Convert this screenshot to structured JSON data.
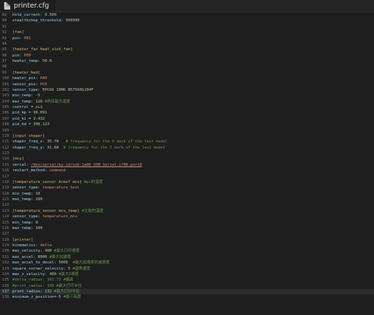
{
  "window": {
    "tab_label": "printer.cfg"
  },
  "colors": {
    "background": "#1e1e1e",
    "key": "#9cdcfe",
    "section": "#d7ba7d",
    "number": "#b5cea8",
    "string": "#ce9178",
    "comment": "#6a9955",
    "line_number": "#858585"
  },
  "editor": {
    "current_line": "137",
    "lines": [
      {
        "n": "89",
        "segs": [
          {
            "t": "hold_current: ",
            "c": "k"
          },
          {
            "t": "0.500",
            "c": "v"
          }
        ]
      },
      {
        "n": "90",
        "segs": [
          {
            "t": "stealthchop_threshold: ",
            "c": "k"
          },
          {
            "t": "999999",
            "c": "v"
          }
        ]
      },
      {
        "n": "91",
        "segs": []
      },
      {
        "n": "92",
        "segs": [
          {
            "t": "[fan]",
            "c": "h"
          }
        ]
      },
      {
        "n": "93",
        "segs": [
          {
            "t": "pin: ",
            "c": "k"
          },
          {
            "t": "PB1",
            "c": "s"
          }
        ]
      },
      {
        "n": "94",
        "segs": []
      },
      {
        "n": "95",
        "segs": [
          {
            "t": "[heater_fan heat_sink_fan]",
            "c": "h"
          }
        ]
      },
      {
        "n": "96",
        "segs": [
          {
            "t": "pin: ",
            "c": "k"
          },
          {
            "t": "PB0",
            "c": "s"
          }
        ]
      },
      {
        "n": "97",
        "segs": [
          {
            "t": "heater_temp: ",
            "c": "k"
          },
          {
            "t": "50.0",
            "c": "v"
          }
        ]
      },
      {
        "n": "98",
        "segs": []
      },
      {
        "n": "99",
        "segs": [
          {
            "t": "[heater_bed]",
            "c": "h"
          }
        ]
      },
      {
        "n": "100",
        "segs": [
          {
            "t": "heater_pin: ",
            "c": "k"
          },
          {
            "t": "PA0",
            "c": "s"
          }
        ]
      },
      {
        "n": "101",
        "segs": [
          {
            "t": "sensor_pin: ",
            "c": "k"
          },
          {
            "t": "PC0",
            "c": "s"
          }
        ]
      },
      {
        "n": "102",
        "segs": [
          {
            "t": "sensor_type: ",
            "c": "k"
          },
          {
            "t": "EPCOS 100K B57560G104F",
            "c": "v"
          }
        ]
      },
      {
        "n": "103",
        "segs": [
          {
            "t": "min_temp: ",
            "c": "k"
          },
          {
            "t": "-5",
            "c": "v"
          }
        ]
      },
      {
        "n": "104",
        "segs": [
          {
            "t": "max_temp: ",
            "c": "k"
          },
          {
            "t": "120 ",
            "c": "v"
          },
          {
            "t": "#热床最大温度",
            "c": "c"
          }
        ]
      },
      {
        "n": "105",
        "segs": [
          {
            "t": "control = ",
            "c": "k"
          },
          {
            "t": "pid",
            "c": "s"
          }
        ]
      },
      {
        "n": "106",
        "segs": [
          {
            "t": "pid_kp = ",
            "c": "k"
          },
          {
            "t": "90.091",
            "c": "v"
          }
        ]
      },
      {
        "n": "107",
        "segs": [
          {
            "t": "pid_ki = ",
            "c": "k"
          },
          {
            "t": "2.432",
            "c": "v"
          }
        ]
      },
      {
        "n": "108",
        "segs": [
          {
            "t": "pid_kd = ",
            "c": "k"
          },
          {
            "t": "300.123",
            "c": "v"
          }
        ]
      },
      {
        "n": "109",
        "segs": []
      },
      {
        "n": "110",
        "segs": [
          {
            "t": "[input_shaper]",
            "c": "h"
          }
        ]
      },
      {
        "n": "111",
        "segs": [
          {
            "t": "shaper_freq_x: ",
            "c": "k"
          },
          {
            "t": "35.78",
            "c": "v"
          },
          {
            "t": "   # frequency for the X mark of the test model",
            "c": "c"
          }
        ]
      },
      {
        "n": "112",
        "segs": [
          {
            "t": "shaper_freq_y: ",
            "c": "k"
          },
          {
            "t": "31.68",
            "c": "v"
          },
          {
            "t": "  # frequency for the Y mark of the test model",
            "c": "c"
          }
        ]
      },
      {
        "n": "113",
        "segs": []
      },
      {
        "n": "114",
        "segs": [
          {
            "t": "[mcu]",
            "c": "h"
          }
        ]
      },
      {
        "n": "115",
        "segs": [
          {
            "t": "serial: ",
            "c": "k"
          },
          {
            "t": "/dev/serial/by-id/usb-1a86_USB_Serial-if00-port0",
            "c": "u"
          }
        ]
      },
      {
        "n": "116",
        "segs": [
          {
            "t": "restart_method: ",
            "c": "k"
          },
          {
            "t": "command",
            "c": "s"
          }
        ]
      },
      {
        "n": "117",
        "segs": []
      },
      {
        "n": "118",
        "segs": [
          {
            "t": "[temperature_sensor Armv7 mcu] ",
            "c": "h"
          },
          {
            "t": "#pi的温度",
            "c": "c"
          }
        ]
      },
      {
        "n": "119",
        "segs": [
          {
            "t": "sensor_type: ",
            "c": "k"
          },
          {
            "t": "temperature_host",
            "c": "s"
          }
        ]
      },
      {
        "n": "120",
        "segs": [
          {
            "t": "min_temp: ",
            "c": "k"
          },
          {
            "t": "10",
            "c": "v"
          }
        ]
      },
      {
        "n": "121",
        "segs": [
          {
            "t": "max_temp: ",
            "c": "k"
          },
          {
            "t": "100",
            "c": "v"
          }
        ]
      },
      {
        "n": "122",
        "segs": []
      },
      {
        "n": "123",
        "segs": [
          {
            "t": "[temperature_sensor mcu_temp] ",
            "c": "h"
          },
          {
            "t": "#主板的温度",
            "c": "c"
          }
        ]
      },
      {
        "n": "124",
        "segs": [
          {
            "t": "sensor_type: ",
            "c": "k"
          },
          {
            "t": "temperature_mcu",
            "c": "s"
          }
        ]
      },
      {
        "n": "125",
        "segs": [
          {
            "t": "min_temp: ",
            "c": "k"
          },
          {
            "t": "0",
            "c": "v"
          }
        ]
      },
      {
        "n": "126",
        "segs": [
          {
            "t": "max_temp: ",
            "c": "k"
          },
          {
            "t": "100",
            "c": "v"
          }
        ]
      },
      {
        "n": "127",
        "segs": []
      },
      {
        "n": "128",
        "segs": [
          {
            "t": "[printer]",
            "c": "h"
          }
        ]
      },
      {
        "n": "129",
        "segs": [
          {
            "t": "kinematics: ",
            "c": "k"
          },
          {
            "t": "delta",
            "c": "s"
          }
        ]
      },
      {
        "n": "130",
        "segs": [
          {
            "t": "max_velocity: ",
            "c": "k"
          },
          {
            "t": "400 ",
            "c": "v"
          },
          {
            "t": "#最大打印速度",
            "c": "c"
          }
        ]
      },
      {
        "n": "131",
        "segs": [
          {
            "t": "max_accel: ",
            "c": "k"
          },
          {
            "t": "8000 ",
            "c": "v"
          },
          {
            "t": "#最大加速度",
            "c": "c"
          }
        ]
      },
      {
        "n": "132",
        "segs": [
          {
            "t": "max_accel_to_decel: ",
            "c": "k"
          },
          {
            "t": "5000",
            "c": "v"
          },
          {
            "t": "  #最大加速度到减速度",
            "c": "c"
          }
        ]
      },
      {
        "n": "133",
        "segs": [
          {
            "t": "square_corner_velocity: ",
            "c": "k"
          },
          {
            "t": "5 ",
            "c": "v"
          },
          {
            "t": "#直角速度",
            "c": "c"
          }
        ]
      },
      {
        "n": "134",
        "segs": [
          {
            "t": "max_z_velocity: ",
            "c": "k"
          },
          {
            "t": "400 ",
            "c": "v"
          },
          {
            "t": "#最大Z速度",
            "c": "c"
          }
        ]
      },
      {
        "n": "135",
        "segs": [
          {
            "t": "#delta_radius: 161.73 #偏高",
            "c": "c"
          }
        ]
      },
      {
        "n": "136",
        "segs": [
          {
            "t": "#print_radius: 150 #最大打印半径",
            "c": "c"
          }
        ]
      },
      {
        "n": "137",
        "segs": [
          {
            "t": "print_radius: ",
            "c": "k"
          },
          {
            "t": "132 ",
            "c": "v"
          },
          {
            "t": "#最大打印半径",
            "c": "c"
          }
        ]
      },
      {
        "n": "138",
        "segs": [
          {
            "t": "minimum_z_position=-5 ",
            "c": "k"
          },
          {
            "t": "#最小高度",
            "c": "c"
          }
        ]
      }
    ]
  }
}
